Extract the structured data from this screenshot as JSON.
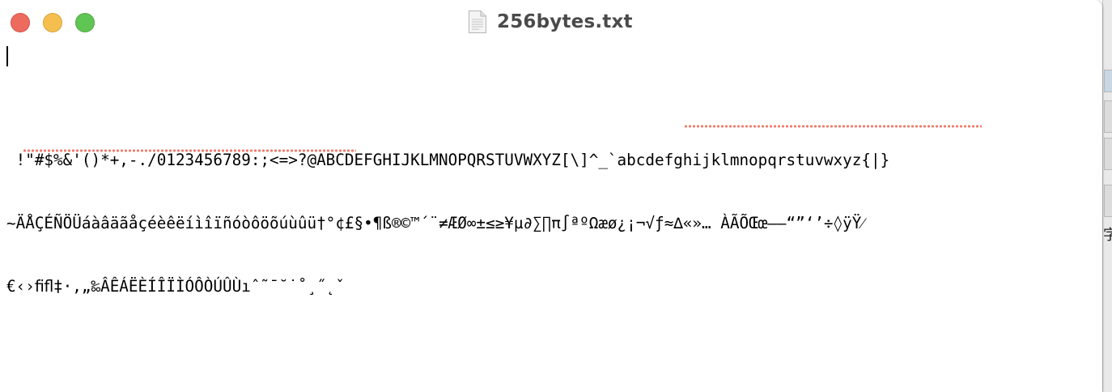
{
  "window": {
    "title": "256bytes.txt",
    "controls": {
      "close": "close-window",
      "minimize": "minimize-window",
      "zoom": "zoom-window"
    },
    "document_icon": "text-document-icon"
  },
  "editor": {
    "lines": [
      " !\"#$%&'()*+,-./0123456789:;<=>?@ABCDEFGHIJKLMNOPQRSTUVWXYZ[\\]^_`abcdefghijklmnopqrstuvwxyz{|}",
      "~ÄÅÇÉÑÖÜáàâäãåçéèêëíìîïñóòôöõúùûü†°¢£§•¶ß®©™´¨≠ÆØ∞±≤≥¥µ∂∑∏π∫ªºΩæø¿¡¬√ƒ≈∆«»… ÀÃÕŒœ–—“”‘’÷◊ÿŸ⁄",
      "€‹›ﬁﬂ‡·‚„‰ÂÊÁËÈÍÎÏÌÓÔÒÚÛÙıˆ˜¯˘˙˚¸˝˛ˇ"
    ]
  },
  "background_window": {
    "glyph": "字"
  },
  "colors": {
    "close": "#ed6a5e",
    "minimize": "#f5bf4f",
    "zoom": "#61c554",
    "spellcheck": "#ef7a6a"
  }
}
